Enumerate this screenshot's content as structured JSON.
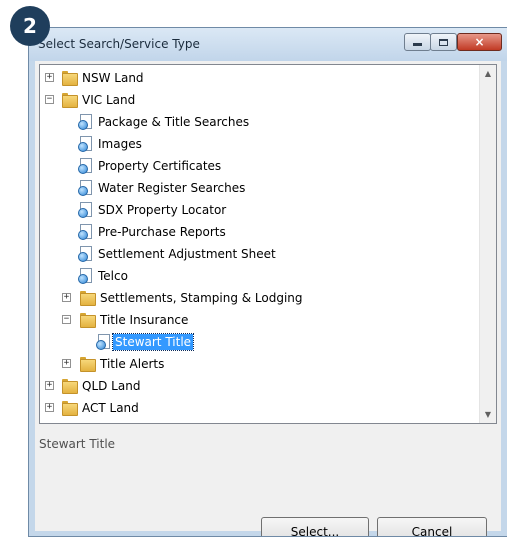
{
  "step_badge": "2",
  "window": {
    "title": "Select Search/Service Type",
    "controls": {
      "minimize": "minimize-icon",
      "maximize": "maximize-icon",
      "close": "×"
    }
  },
  "tree": {
    "items": [
      {
        "label": "NSW Land",
        "kind": "folder",
        "expander": "+"
      },
      {
        "label": "VIC Land",
        "kind": "folder",
        "expander": "−"
      },
      {
        "label": "Package & Title Searches",
        "kind": "service"
      },
      {
        "label": "Images",
        "kind": "service"
      },
      {
        "label": "Property Certificates",
        "kind": "service"
      },
      {
        "label": "Water Register Searches",
        "kind": "service"
      },
      {
        "label": "SDX Property Locator",
        "kind": "service"
      },
      {
        "label": "Pre-Purchase Reports",
        "kind": "service"
      },
      {
        "label": "Settlement Adjustment Sheet",
        "kind": "service"
      },
      {
        "label": "Telco",
        "kind": "service"
      },
      {
        "label": "Settlements, Stamping & Lodging",
        "kind": "folder",
        "expander": "+"
      },
      {
        "label": "Title Insurance",
        "kind": "folder",
        "expander": "−"
      },
      {
        "label": "Stewart Title",
        "kind": "service",
        "selected": true
      },
      {
        "label": "Title Alerts",
        "kind": "folder",
        "expander": "+"
      },
      {
        "label": "QLD Land",
        "kind": "folder",
        "expander": "+"
      },
      {
        "label": "ACT Land",
        "kind": "folder",
        "expander": "+"
      }
    ],
    "scroll_up": "▲",
    "scroll_down": "▼"
  },
  "status": "Stewart Title",
  "buttons": {
    "select": "Select...",
    "cancel": "Cancel"
  },
  "colors": {
    "selection": "#3399ff",
    "badge": "#1f3e5c",
    "close_button": "#c13a24"
  }
}
